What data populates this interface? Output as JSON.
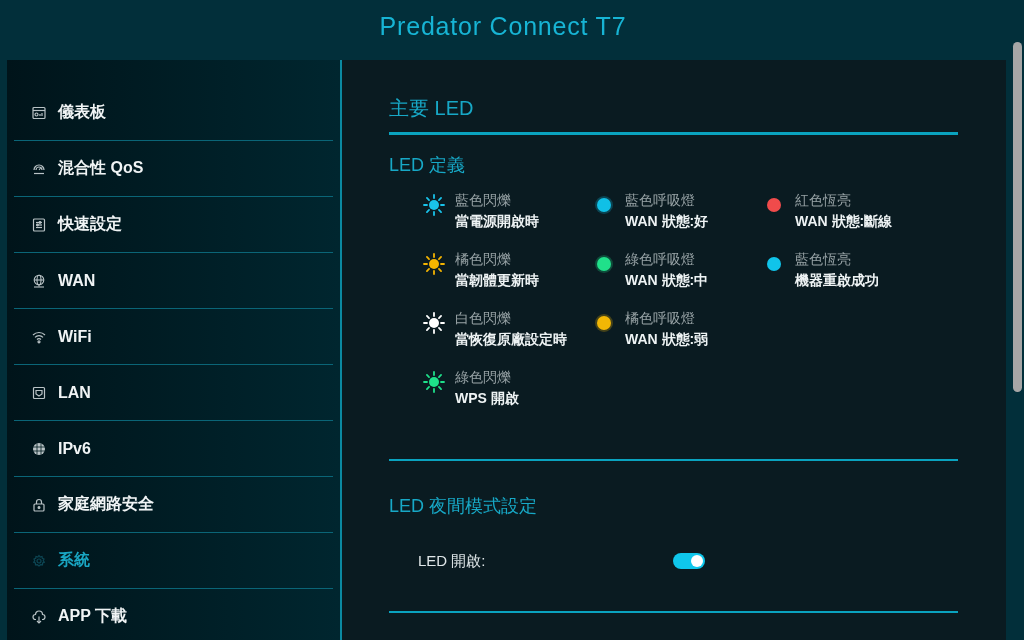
{
  "header": {
    "title": "Predator Connect T7"
  },
  "sidebar": {
    "items": [
      {
        "label": "儀表板",
        "selected": false
      },
      {
        "label": "混合性 QoS",
        "selected": false
      },
      {
        "label": "快速設定",
        "selected": false
      },
      {
        "label": "WAN",
        "selected": false
      },
      {
        "label": "WiFi",
        "selected": false
      },
      {
        "label": "LAN",
        "selected": false
      },
      {
        "label": "IPv6",
        "selected": false
      },
      {
        "label": "家庭網路安全",
        "selected": false
      },
      {
        "label": "系統",
        "selected": true
      },
      {
        "label": "APP 下載",
        "selected": false
      }
    ]
  },
  "section": {
    "title": "主要 LED"
  },
  "legend": {
    "title": "LED 定義",
    "columns": [
      {
        "items": [
          {
            "kind": "blink",
            "color": "#19c3ea",
            "name": "藍色閃爍",
            "meaning": "當電源開啟時"
          },
          {
            "kind": "blink",
            "color": "#f4b400",
            "name": "橘色閃爍",
            "meaning": "當韌體更新時"
          },
          {
            "kind": "blink",
            "color": "#ffffff",
            "name": "白色閃爍",
            "meaning": "當恢復原廠設定時"
          },
          {
            "kind": "blink",
            "color": "#1ee08a",
            "name": "綠色閃爍",
            "meaning": "WPS 開啟"
          }
        ]
      },
      {
        "items": [
          {
            "kind": "breathing",
            "color": "#10c0e6",
            "name": "藍色呼吸燈",
            "meaning": "WAN 狀態:好"
          },
          {
            "kind": "breathing",
            "color": "#20e08a",
            "name": "綠色呼吸燈",
            "meaning": "WAN 狀態:中"
          },
          {
            "kind": "breathing",
            "color": "#f2b705",
            "name": "橘色呼吸燈",
            "meaning": "WAN 狀態:弱"
          }
        ]
      },
      {
        "items": [
          {
            "kind": "solid",
            "color": "#f04b4b",
            "name": "紅色恆亮",
            "meaning": "WAN 狀態:斷線"
          },
          {
            "kind": "solid",
            "color": "#10c4ea",
            "name": "藍色恆亮",
            "meaning": "機器重啟成功"
          }
        ]
      }
    ]
  },
  "night_mode": {
    "title": "LED 夜間模式設定",
    "led_toggle": {
      "label": "LED 開啟:",
      "on": true
    }
  }
}
